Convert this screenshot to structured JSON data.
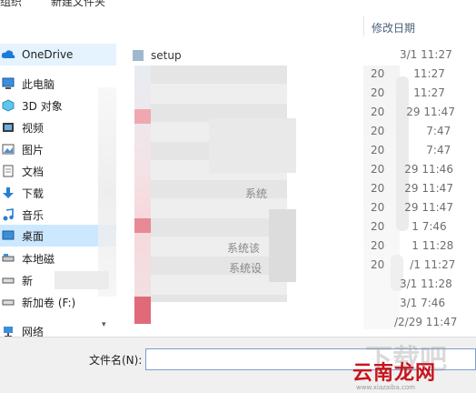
{
  "toolbar": {
    "item_left": "组织",
    "item_new_folder": "新建文件夹"
  },
  "nav": {
    "items": [
      {
        "label": "OneDrive",
        "icon": "cloud-icon"
      },
      {
        "label": "此电脑",
        "icon": "computer-icon"
      },
      {
        "label": "3D 对象",
        "icon": "cube-icon"
      },
      {
        "label": "视频",
        "icon": "video-icon"
      },
      {
        "label": "图片",
        "icon": "picture-icon"
      },
      {
        "label": "文档",
        "icon": "document-icon"
      },
      {
        "label": "下载",
        "icon": "download-icon"
      },
      {
        "label": "音乐",
        "icon": "music-icon"
      },
      {
        "label": "桌面",
        "icon": "desktop-icon"
      },
      {
        "label": "本地磁",
        "icon": "drive-icon"
      },
      {
        "label": "新",
        "icon": "drive-icon"
      },
      {
        "label": "新加卷 (F:)",
        "icon": "drive-icon"
      },
      {
        "label": "网络",
        "icon": "network-icon"
      }
    ]
  },
  "file_list": {
    "header_date": "修改日期",
    "first_file": "setup",
    "partial_names": [
      "系统",
      "系统该",
      "系统设"
    ],
    "dates": [
      "3/1 11:27",
      "11:27",
      "11:27",
      "29 11:47",
      "7:47",
      "7:47",
      "29 11:46",
      "29 11:47",
      "29 11:47",
      "1 7:46",
      "1 11:28",
      "/1 11:27",
      "3/1 11:28",
      "3/1 7:46",
      "/2/29 11:47"
    ],
    "date_prefixes": [
      "",
      "20",
      "20",
      "20",
      "20",
      "20",
      "20",
      "20",
      "20",
      "20",
      "20",
      "20",
      "",
      "",
      ""
    ]
  },
  "footer": {
    "filename_label": "文件名(N):",
    "filename_value": ""
  },
  "watermark": {
    "main": "云南龙网",
    "ghost": "下载吧",
    "small": "www.xiazaiba.com"
  }
}
